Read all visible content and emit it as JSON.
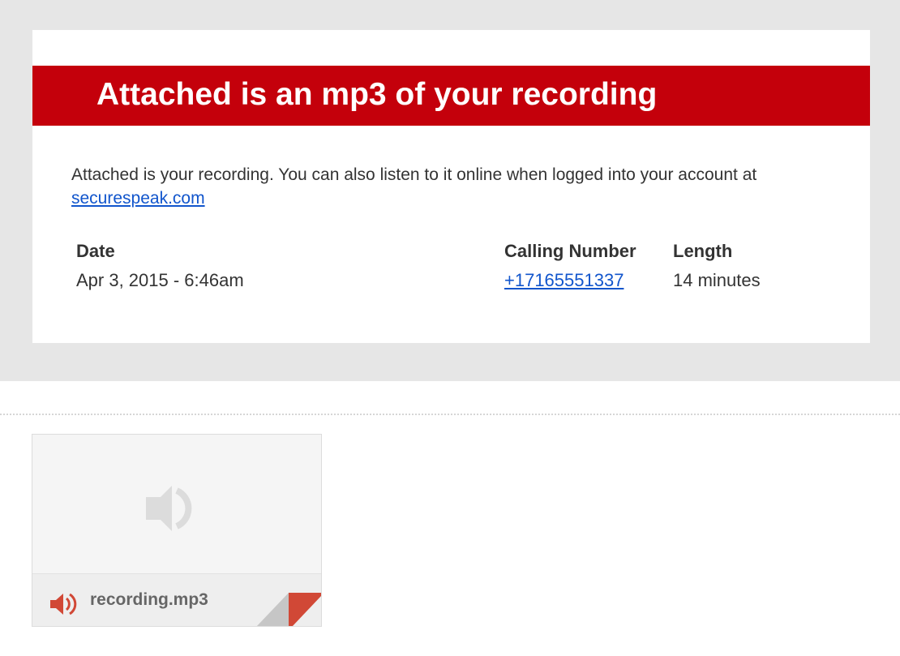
{
  "email": {
    "banner_title": "Attached is an mp3 of your recording",
    "intro_text": "Attached is your recording. You can also listen to it online when logged into your account at",
    "intro_link": "securespeak.com",
    "details": {
      "date_header": "Date",
      "date_value": "Apr 3, 2015 - 6:46am",
      "calling_header": "Calling Number",
      "calling_value": "+17165551337",
      "length_header": "Length",
      "length_value": "14 minutes"
    }
  },
  "attachment": {
    "filename": "recording.mp3",
    "icon": "speaker-icon"
  },
  "colors": {
    "banner": "#c4000b",
    "link": "#1155cc",
    "background": "#e6e6e6",
    "attachment_icon": "#d14836"
  }
}
